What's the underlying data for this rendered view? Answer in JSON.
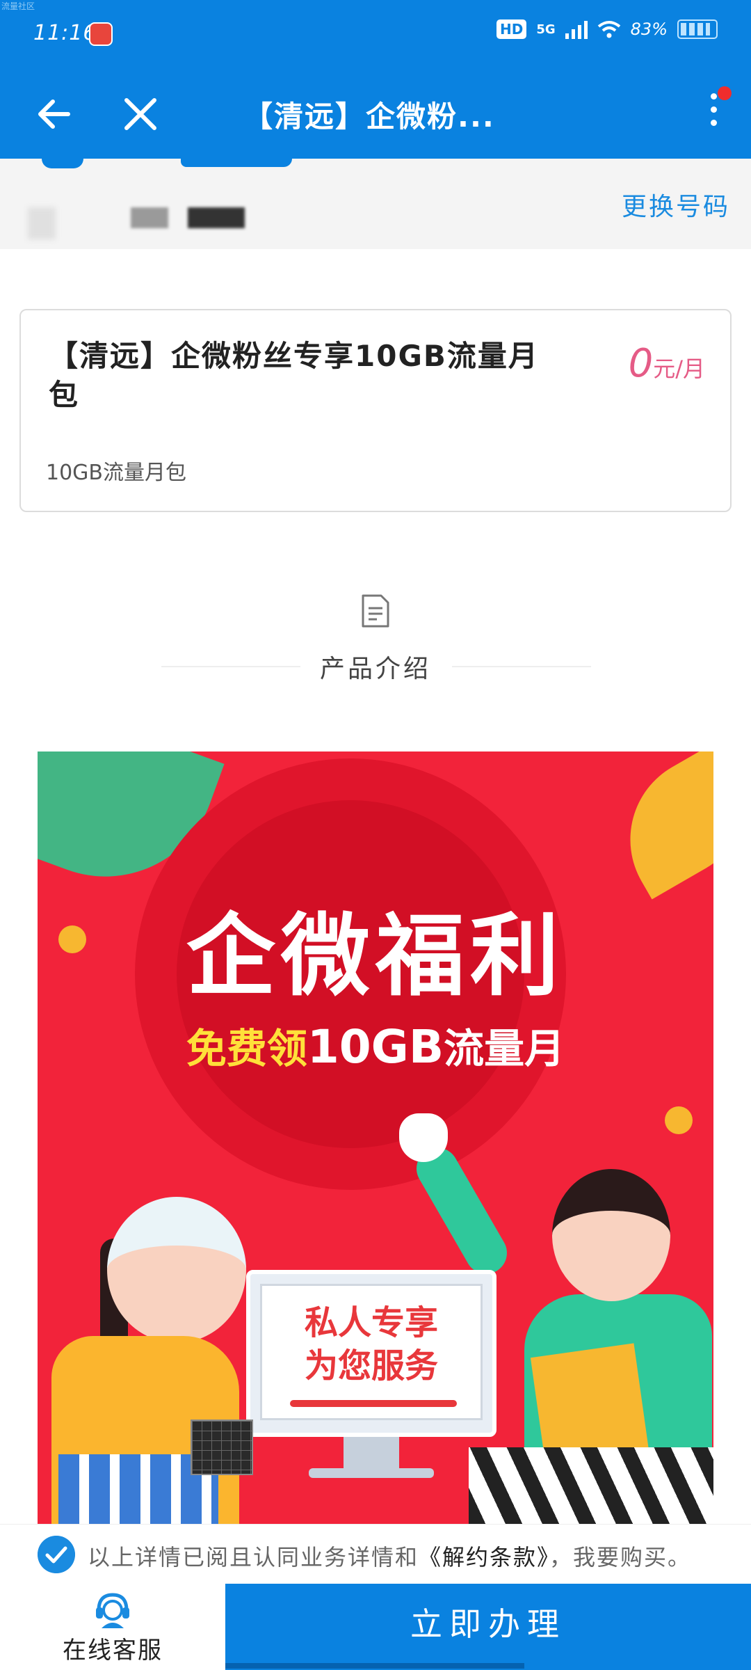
{
  "status_bar": {
    "time": "11:16",
    "network_label": "5G",
    "battery_percent": "83%",
    "hd_label": "HD",
    "watermark": "流量社区"
  },
  "app_bar": {
    "title": "【清远】企微粉...",
    "colors": {
      "bar": "#0a82e0",
      "notification_dot": "#f02d2d"
    }
  },
  "number_bar": {
    "change_number_label": "更换号码"
  },
  "plan": {
    "name": "【清远】企微粉丝专享10GB流量月包",
    "price": "0",
    "price_unit": "元/月",
    "description": "10GB流量月包",
    "price_color": "#e55b86"
  },
  "product_intro": {
    "title": "产品介绍"
  },
  "banner": {
    "headline": "企微福利",
    "sub_free": "免费领",
    "sub_size": "10GB",
    "sub_rest": "流量月",
    "screen_line1": "私人专享",
    "screen_line2": "为您服务"
  },
  "agreement": {
    "checked": true,
    "text_before": "以上详情已阅且认同业务详情和",
    "link": "《解约条款》",
    "text_after": "，我要购买。"
  },
  "bottom_actions": {
    "customer_service_label": "在线客服",
    "apply_label": "立即办理"
  }
}
